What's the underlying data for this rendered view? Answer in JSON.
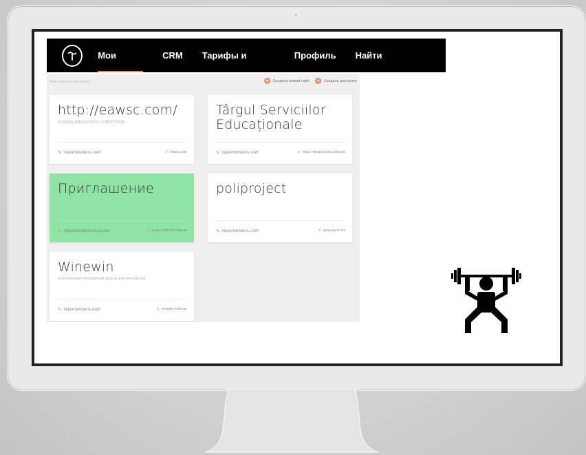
{
  "colors": {
    "accent": "#f4845f",
    "green_card": "#8fe3a4",
    "topbar": "#000000"
  },
  "nav": {
    "logo_icon": "tilda-logo-icon",
    "items": [
      {
        "label": "Мои сайты",
        "active": true
      },
      {
        "label": "CRM",
        "active": false
      },
      {
        "label": "Тарифы и оплата",
        "active": false
      },
      {
        "label": "Профиль",
        "active": false
      },
      {
        "label": "Найти дизайнера",
        "active": false
      }
    ]
  },
  "subbar": {
    "left_text": "Мои сайты и рассылки",
    "create_site": "Создать новый сайт",
    "create_mailing": "Создать рассылку"
  },
  "cards": [
    {
      "title": "http://eawsc.com/",
      "subtitle": "EURASIA WINE&SPIRITS COMPETITION",
      "edit_label": "РЕДАКТИРОВАТЬ САЙТ",
      "link": "eawsc.com"
    },
    {
      "title": "Târgul Serviciilor Educaționale",
      "subtitle": "",
      "edit_label": "РЕДАКТИРОВАТЬ САЙТ",
      "link": "https://targeducate.tilda.ws"
    },
    {
      "title": "Приглашение",
      "subtitle": "",
      "edit_label": "РЕДАКТИРОВАТЬ РАССЫЛКУ",
      "link": "project793745.tilda.ws"
    },
    {
      "title": "poliproject",
      "subtitle": "",
      "edit_label": "РЕДАКТИРОВАТЬ САЙТ",
      "link": "poliproject.md"
    },
    {
      "title": "Winewin",
      "subtitle": "крупнейший молдавский форум для виноделов",
      "edit_label": "РЕДАКТИРОВАТЬ САЙТ",
      "link": "winewin.tilda.ws"
    }
  ],
  "decor": {
    "lifter_icon": "weightlifter-icon"
  }
}
